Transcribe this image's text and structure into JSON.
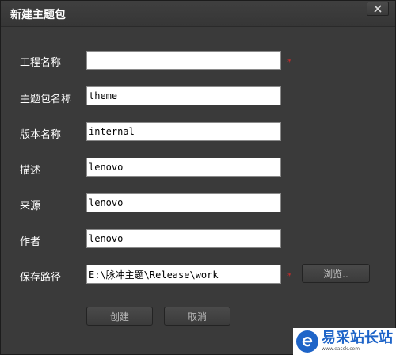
{
  "dialog": {
    "title": "新建主题包",
    "close_icon": "close-icon"
  },
  "form": {
    "fields": [
      {
        "label": "工程名称",
        "value": "",
        "required": true
      },
      {
        "label": "主题包名称",
        "value": "theme",
        "required": false
      },
      {
        "label": "版本名称",
        "value": "internal",
        "required": false
      },
      {
        "label": "描述",
        "value": "lenovo",
        "required": false
      },
      {
        "label": "来源",
        "value": "lenovo",
        "required": false
      },
      {
        "label": "作者",
        "value": "lenovo",
        "required": false
      },
      {
        "label": "保存路径",
        "value": "E:\\脉冲主题\\Release\\work",
        "required": true
      }
    ],
    "required_mark": "*",
    "browse_label": "浏览.."
  },
  "actions": {
    "create_label": "创建",
    "cancel_label": "取消"
  },
  "watermark": {
    "text": "易采站长站",
    "subtext": "www.easck.com",
    "logo_icon": "e-logo-icon"
  },
  "colors": {
    "background": "#3a3a3a",
    "label_text": "#ffffff",
    "required_mark": "#d22b2b",
    "button_text": "#b9b9b9",
    "watermark_brand": "#1e64c8"
  }
}
